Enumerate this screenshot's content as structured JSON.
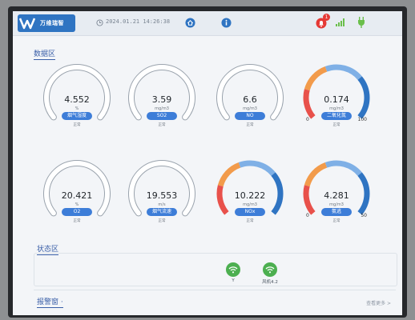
{
  "header": {
    "brand": "万维瑞智",
    "datetime": "2024.01.21 14:26:38",
    "alarm_count": "1",
    "icons": [
      "clock-icon",
      "home-icon",
      "info-icon",
      "alarm-bell-icon",
      "signal-bars-icon",
      "plug-icon"
    ]
  },
  "sections": {
    "data": "数据区",
    "status": "状态区",
    "alarm": "报警窗 ·",
    "alarm_hint": "查看更多 >"
  },
  "colors": {
    "accent": "#3d7dd8",
    "arc_grey": "#d9dee4",
    "arc_outline": "#9aa3ad",
    "gradient": [
      "#e8514b",
      "#f29b4b",
      "#7fb0e6",
      "#2f74c2"
    ],
    "status_ok": "#4caf50"
  },
  "gauges": [
    {
      "value": "4.552",
      "unit": "%",
      "name": "烟气湿度",
      "status": "正常",
      "style": "plain"
    },
    {
      "value": "3.59",
      "unit": "mg/m3",
      "name": "SO2",
      "status": "正常",
      "style": "plain"
    },
    {
      "value": "6.6",
      "unit": "mg/m3",
      "name": "NO",
      "status": "正常",
      "style": "plain"
    },
    {
      "value": "0.174",
      "unit": "mg/m3",
      "name": "二氧化氮",
      "status": "正常",
      "style": "color",
      "min": "0",
      "max": "100"
    },
    {
      "value": "20.421",
      "unit": "%",
      "name": "O2",
      "status": "正常",
      "style": "plain"
    },
    {
      "value": "19.553",
      "unit": "m/s",
      "name": "烟气流速",
      "status": "正常",
      "style": "plain"
    },
    {
      "value": "10.222",
      "unit": "mg/m3",
      "name": "NOx",
      "status": "正常",
      "style": "color"
    },
    {
      "value": "4.281",
      "unit": "mg/m3",
      "name": "氨逃",
      "status": "正常",
      "style": "color",
      "min": "0",
      "max": "50"
    }
  ],
  "status_items": [
    {
      "label": "Y",
      "icon": "wifi-icon"
    },
    {
      "label": "风机4.2",
      "icon": "wifi-icon"
    }
  ]
}
